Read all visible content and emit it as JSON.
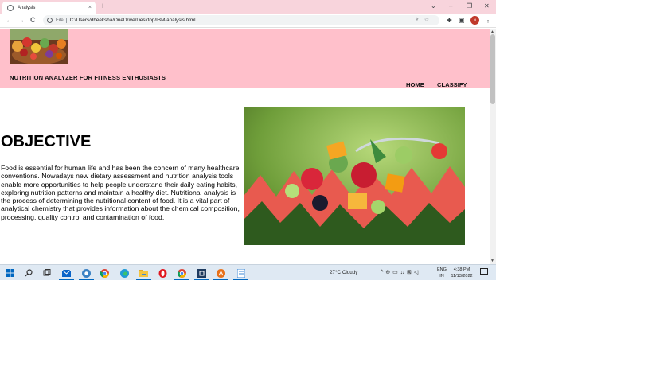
{
  "browser": {
    "tab_title": "Analysis",
    "tab_close": "×",
    "new_tab": "+",
    "window_controls": [
      "⌄",
      "–",
      "❐",
      "✕"
    ],
    "back": "←",
    "forward": "→",
    "reload": "C",
    "scheme_label": "File",
    "url": "C:/Users/dheeksha/OneDrive/Desktop/IBM/analysis.html",
    "profile_initial": "s"
  },
  "site": {
    "title": "NUTRITION ANALYZER FOR FITNESS ENTHUSIASTS",
    "nav": {
      "home": "HOME",
      "classify": "CLASSIFY"
    },
    "objective": {
      "heading": "OBJECTIVE",
      "text": "Food is essential for human life and has been the concern of many healthcare conventions. Nowadays new dietary assessment and nutrition analysis tools enable more opportunities to help people understand their daily eating habits, exploring nutrition patterns and maintain a healthy diet. Nutritional analysis is the process of determining the nutritional content of food. It is a vital part of analytical chemistry that provides information about the chemical composition, processing, quality control and contamination of food."
    }
  },
  "taskbar": {
    "weather": "27°C  Cloudy",
    "lang_line1": "ENG",
    "lang_line2": "IN",
    "time": "4:38 PM",
    "date": "11/13/2022",
    "apps": [
      "start-icon",
      "search-icon",
      "task-view-icon",
      "mail-icon",
      "chrome-icon",
      "chrome-icon",
      "edge-icon",
      "file-explorer-icon",
      "opera-icon",
      "chrome-icon",
      "vscode-icon",
      "app-icon",
      "notepad-icon"
    ]
  }
}
